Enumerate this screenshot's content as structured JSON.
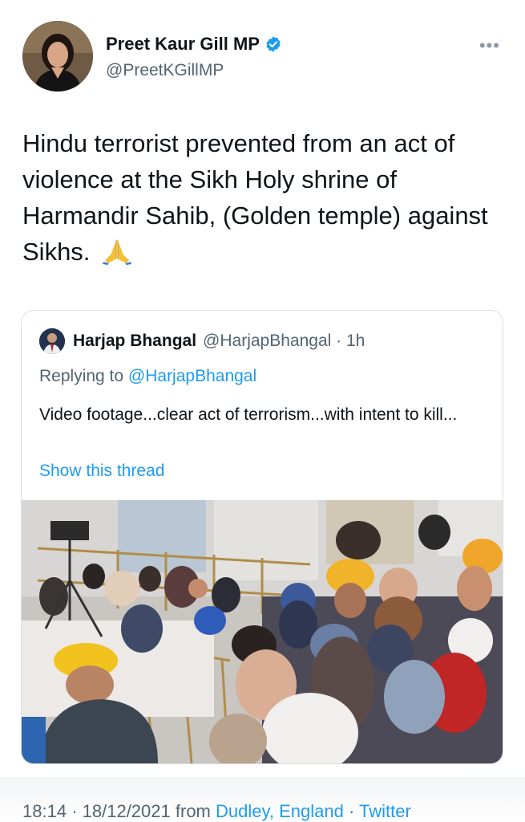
{
  "tweet": {
    "author_name": "Preet Kaur Gill MP",
    "author_handle": "@PreetKGillMP",
    "text": "Hindu terrorist prevented from an act of violence at the Sikh Holy shrine of Harmandir Sahib, (Golden temple) against Sikhs.",
    "emoji": "folded-hands-emoji",
    "more_label": "•••",
    "verified_badge_color": "#1d9bf0"
  },
  "quoted": {
    "author_name": "Harjap Bhangal",
    "author_handle": "@HarjapBhangal",
    "time": "1h",
    "replying_prefix": "Replying to",
    "replying_handle": "@HarjapBhangal",
    "text": "Video footage...clear act of terrorism...with intent to kill...",
    "show_thread": "Show this thread",
    "media_description_icon": "cctv-video-thumbnail"
  },
  "footer": {
    "time": "18:14",
    "date": "18/12/2021",
    "from_label": "from",
    "location": "Dudley, England",
    "source": "Twitter"
  },
  "colors": {
    "link": "#1d9bf0",
    "secondary_text": "#536471",
    "primary_text": "#0f1419"
  }
}
